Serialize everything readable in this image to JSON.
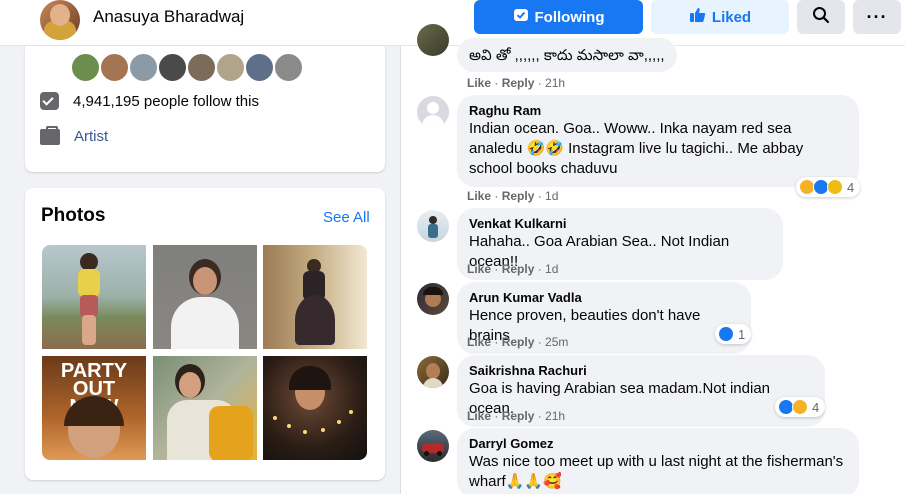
{
  "header": {
    "page_name": "Anasuya Bharadwaj",
    "following_label": "Following",
    "liked_label": "Liked",
    "search_icon": "search-icon",
    "more_label": "···"
  },
  "about": {
    "followers_text": "4,941,195 people follow this",
    "category": "Artist",
    "friend_avatars": [
      "#6b8e4e",
      "#a47552",
      "#8c9aa6",
      "#4a4a4a",
      "#7c6a5a",
      "#b0a48a",
      "#5e6f8a",
      "#8a8a8a"
    ]
  },
  "photos": {
    "title": "Photos",
    "see_all": "See All",
    "overlay_text": "PARTY OUT NOW"
  },
  "comments": [
    {
      "name": "",
      "text": "అవి తో ,,,,,, కాదు మసాలా వా,,,,,",
      "like": "Like",
      "reply": "Reply",
      "time": "21h",
      "reactions": null
    },
    {
      "name": "Raghu Ram",
      "text": "Indian ocean. Goa.. Woww.. Inka nayam red sea analedu 🤣🤣 Instagram live lu tagichi.. Me abbay school books chaduvu",
      "like": "Like",
      "reply": "Reply",
      "time": "1d",
      "reactions": {
        "types": [
          "haha",
          "like",
          "wow"
        ],
        "count": "4"
      }
    },
    {
      "name": "Venkat Kulkarni",
      "text": "Hahaha.. Goa Arabian Sea.. Not Indian ocean!!",
      "like": "Like",
      "reply": "Reply",
      "time": "1d",
      "reactions": null
    },
    {
      "name": "Arun Kumar Vadla",
      "text": "Hence proven, beauties don't have brains",
      "like": "Like",
      "reply": "Reply",
      "time": "25m",
      "reactions": {
        "types": [
          "like"
        ],
        "count": "1"
      }
    },
    {
      "name": "Saikrishna Rachuri",
      "text": "Goa is having Arabian sea madam.Not indian ocean.",
      "like": "Like",
      "reply": "Reply",
      "time": "21h",
      "reactions": {
        "types": [
          "like",
          "haha"
        ],
        "count": "4"
      }
    },
    {
      "name": "Darryl Gomez",
      "text": "Was nice too meet up with u last night at the fisherman's wharf🙏🙏🥰",
      "like": "",
      "reply": "",
      "time": "",
      "reactions": null
    }
  ],
  "colors": {
    "accent": "#1877f2",
    "liked_bg": "#e7f3ff",
    "page_bg": "#f0f2f5"
  }
}
